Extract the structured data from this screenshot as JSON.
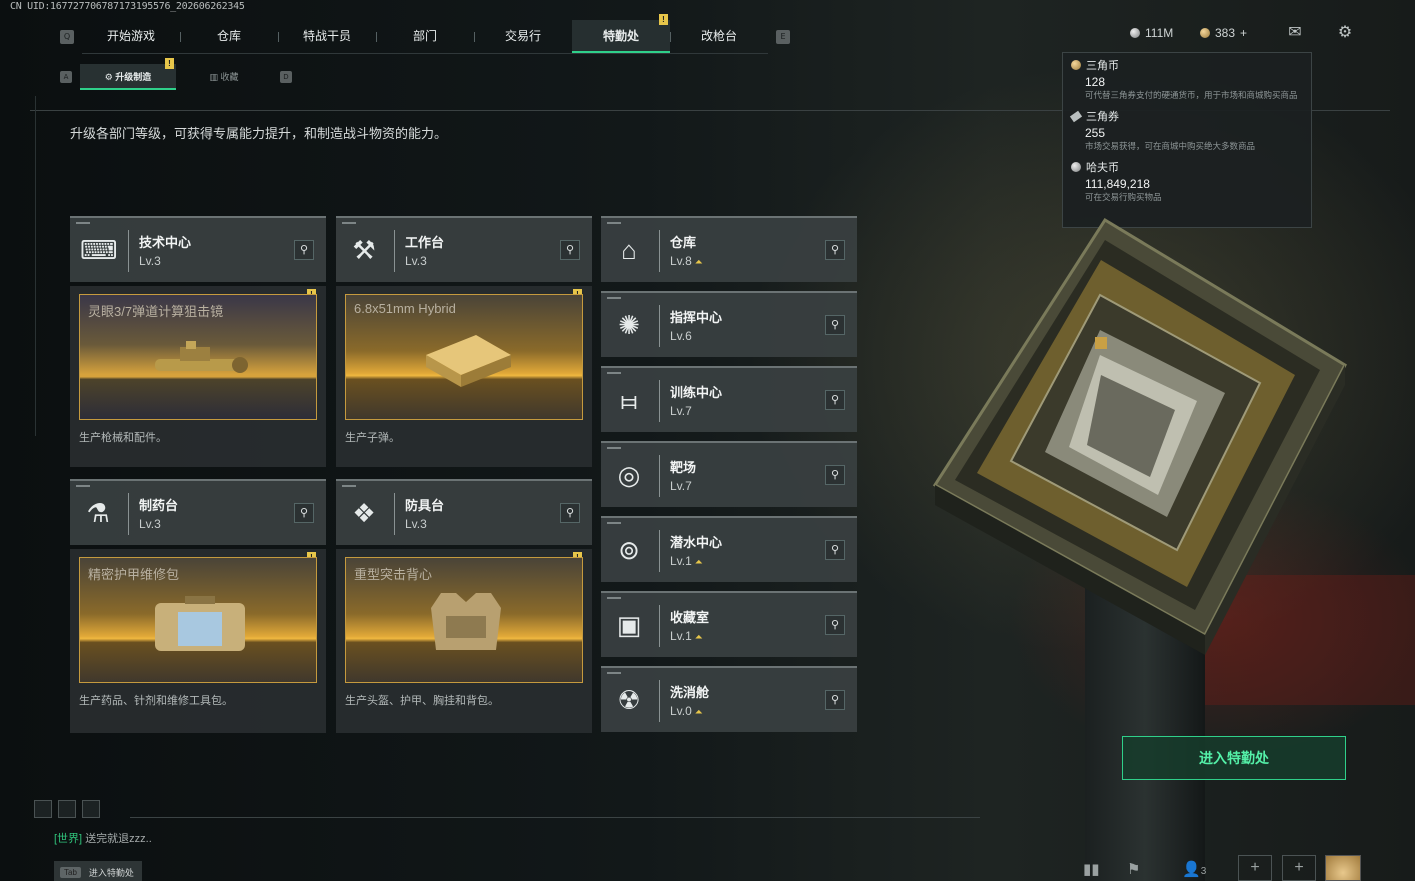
{
  "uid": "CN UID:167727706787173195576_202606262345",
  "nav": {
    "left_key": "Q",
    "right_key": "E",
    "tabs": [
      "开始游戏",
      "仓库",
      "特战干员",
      "部门",
      "交易行",
      "特勤处",
      "改枪台"
    ],
    "active_tab": "特勤处"
  },
  "subnav": {
    "left_key": "A",
    "right_key": "D",
    "tabs": [
      "升级制造",
      "收藏"
    ],
    "active_tab": "升级制造"
  },
  "description": "升级各部门等级，可获得专属能力提升，和制造战斗物资的能力。",
  "currency": {
    "coins": "111M",
    "tickets": "383",
    "plus": "+"
  },
  "tooltip": {
    "items": [
      {
        "name": "三角币",
        "value": "128",
        "desc": "可代替三角券支付的硬通货币，用于市场和商城购买商品"
      },
      {
        "name": "三角券",
        "value": "255",
        "desc": "市场交易获得，可在商城中购买绝大多数商品"
      },
      {
        "name": "哈夫币",
        "value": "111,849,218",
        "desc": "可在交易行购买物品"
      }
    ]
  },
  "craft_cards": [
    {
      "name": "技术中心",
      "level": "Lv.3",
      "product_title": "灵眼3/7弹道计算狙击镜",
      "product_desc": "生产枪械和配件。"
    },
    {
      "name": "工作台",
      "level": "Lv.3",
      "product_title": "6.8x51mm Hybrid",
      "product_desc": "生产子弹。"
    },
    {
      "name": "制药台",
      "level": "Lv.3",
      "product_title": "精密护甲维修包",
      "product_desc": "生产药品、针剂和维修工具包。"
    },
    {
      "name": "防具台",
      "level": "Lv.3",
      "product_title": "重型突击背心",
      "product_desc": "生产头盔、护甲、胸挂和背包。"
    }
  ],
  "departments": [
    {
      "name": "仓库",
      "level": "Lv.8",
      "upgradable": true
    },
    {
      "name": "指挥中心",
      "level": "Lv.6",
      "upgradable": false
    },
    {
      "name": "训练中心",
      "level": "Lv.7",
      "upgradable": false
    },
    {
      "name": "靶场",
      "level": "Lv.7",
      "upgradable": false
    },
    {
      "name": "潜水中心",
      "level": "Lv.1",
      "upgradable": true
    },
    {
      "name": "收藏室",
      "level": "Lv.1",
      "upgradable": true
    },
    {
      "name": "洗消舱",
      "level": "Lv.0",
      "upgradable": true
    }
  ],
  "alert_mark": "!",
  "enter_button": "进入特勤处",
  "chat": {
    "channel": "[世界]",
    "message": "送完就退zzz.."
  },
  "tab_hint": {
    "key": "Tab",
    "label": "进入特勤处"
  },
  "bottom_bar": {
    "friends_count": "3"
  },
  "colors": {
    "accent": "#2fd08a",
    "alert": "#e7c64a",
    "panel": "#3a4041"
  }
}
